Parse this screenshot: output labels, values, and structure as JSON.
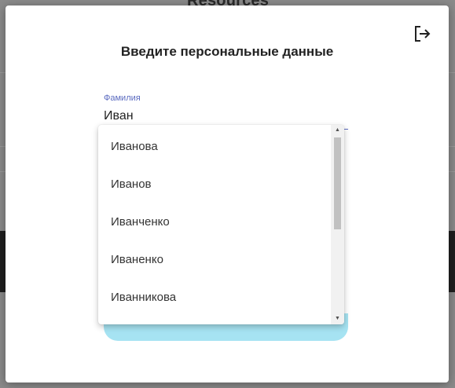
{
  "background": {
    "title": "Resources"
  },
  "modal": {
    "title": "Введите персональные данные",
    "logout_icon": "logout-icon"
  },
  "surname_field": {
    "label": "Фамилия",
    "value": "Иван"
  },
  "dropdown": {
    "options": [
      "Иванова",
      "Иванов",
      "Иванченко",
      "Иваненко",
      "Иванникова"
    ]
  },
  "colors": {
    "accent": "#5b6bc0",
    "button": "#a6e3f2"
  }
}
